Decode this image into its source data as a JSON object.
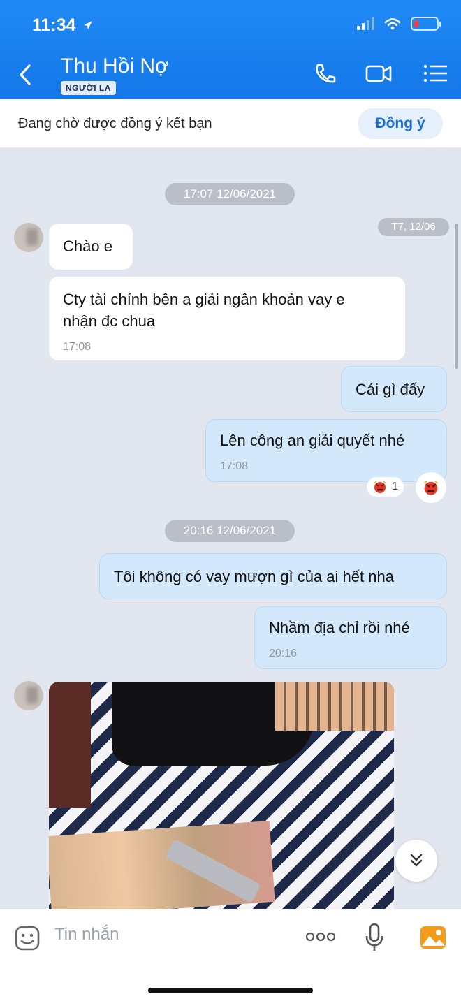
{
  "status_bar": {
    "time": "11:34"
  },
  "header": {
    "contact_name": "Thu Hồi Nợ",
    "badge": "NGƯỜI LẠ"
  },
  "friend_request": {
    "text": "Đang chờ được đồng ý kết bạn",
    "accept_label": "Đồng ý"
  },
  "conversation": {
    "date_pill_1": "17:07 12/06/2021",
    "side_date": "T7, 12/06",
    "msg_1": "Chào e",
    "msg_2_line_1": "Cty tài chính bên a giải ngân khoản vay e",
    "msg_2_line_2": "nhận đc chua",
    "msg_2_time": "17:08",
    "msg_3": "Cái gì đấy",
    "msg_4": "Lên công an giải quyết nhé",
    "msg_4_time": "17:08",
    "msg_4_reaction_count": "1",
    "date_pill_2": "20:16 12/06/2021",
    "msg_5": "Tôi không có vay mượn gì của ai hết nha",
    "msg_6": "Nhầm địa chỉ rồi nhé",
    "msg_6_time": "20:16"
  },
  "composer": {
    "placeholder": "Tin nhắn"
  },
  "colors": {
    "header_blue": "#1478e8",
    "outgoing_bubble": "#d3e9fb",
    "chat_bg": "#e2e6ee",
    "accent": "#1a6fd8"
  }
}
